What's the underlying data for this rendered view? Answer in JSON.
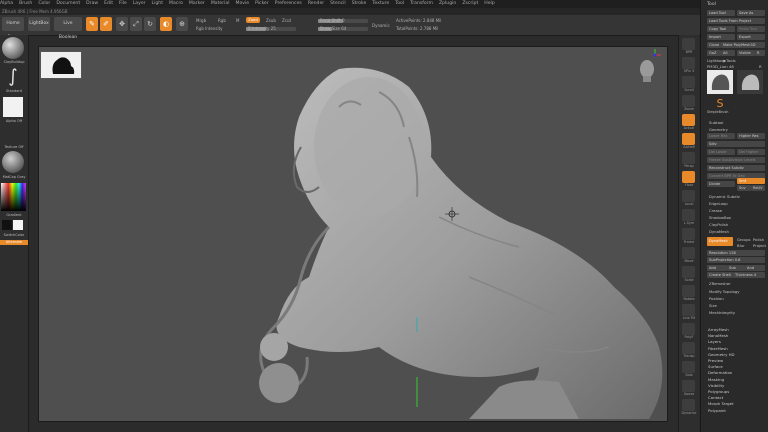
{
  "menu": [
    "Alpha",
    "Brush",
    "Color",
    "Document",
    "Draw",
    "Edit",
    "File",
    "Layer",
    "Light",
    "Macro",
    "Marker",
    "Material",
    "Movie",
    "Picker",
    "Preferences",
    "Render",
    "Stencil",
    "Stroke",
    "Texture",
    "Tool",
    "Transform",
    "Zplugin",
    "Zscript",
    "Help"
  ],
  "status_line": "ZBrush 4R6 | Free Mem 4.956GB",
  "toolbar": {
    "home_page": "Home Page",
    "lightbox": "LightBox",
    "live_boolean": "Live Boolean",
    "edit": "Edit",
    "draw": "Draw",
    "move": "Move",
    "scale": "Scale",
    "rotate": "Rotate",
    "mrgb": "Mrgb",
    "rgb": "Rgb",
    "m": "M",
    "zadd": "Zadd",
    "zsub": "Zsub",
    "zcut": "Zcut",
    "rgb_intensity": "Rgb Intensity",
    "z_intensity": "Z Intensity 25",
    "focal_shift": "Focal Shift 0",
    "draw_size": "Draw Size 64",
    "dynamic": "Dynamic",
    "active_points": "ActivePoints: 2.848 Mil",
    "total_points": "TotalPoints: 2.788 Mil"
  },
  "leftshelf": {
    "brush1": "ClayBuildup",
    "brush2": "Standard",
    "stroke": "FreeHand",
    "alpha": "Alpha Off",
    "texture": "Texture Off",
    "material": "MatCap Gray",
    "gradient": "Gradient",
    "switch_color": "SwitchColor",
    "alternate": "Alternate"
  },
  "rightshelf": [
    "BPR",
    "SPix 3",
    "Scroll",
    "Zoom",
    "Actual",
    "AAHalf",
    "Persp",
    "Floor",
    "Local",
    "L.Sym",
    "Frame",
    "Move",
    "Scale",
    "Rotate",
    "Line Fill",
    "PolyF",
    "Transp",
    "Solo",
    "Xpose",
    "Dynamic"
  ],
  "tool_panel": {
    "title": "Tool",
    "load_tool": "Load Tool",
    "save_as": "Save As",
    "load_tools_from_project": "Load Tools From Project",
    "copy_tool": "Copy Tool",
    "paste_tool": "Paste Tool",
    "import": "Import",
    "export": "Export",
    "clone": "Clone",
    "make_polymesh": "Make PolyMesh3D",
    "goz": "GoZ",
    "all": "All",
    "visible": "Visible",
    "r": "R",
    "lightbox_tools": "Lightbox▶Tools",
    "current_tool": "PM3D_Lion 48",
    "r_value": "R",
    "simple_brush": "SimpleBrush",
    "items": [
      "Subtool",
      "Geometry",
      "Lower Res",
      "Higher Res",
      "Sdiv",
      "Del Lower",
      "Del Higher",
      "Freeze SubDivision Levels",
      "Reconstruct Subdiv",
      "Convert BPR To Geo",
      "Divide",
      "Smt",
      "Suv",
      "ReUV",
      "Dynamic Subdiv",
      "EdgeLoop",
      "Crease",
      "ShadowBox",
      "ClayPolish",
      "DynaMesh"
    ],
    "dynamesh": "DynaMesh",
    "groups": "Groups",
    "polish": "Polish",
    "blur": "Blur",
    "project": "Project",
    "resolution": "Resolution 128",
    "subprojection": "SubProjection 0.6",
    "add": "Add",
    "sub": "Sub",
    "and": "And",
    "create_shell": "Create Shell",
    "thickness": "Thickness 4",
    "more": [
      "ZRemesher",
      "Modify Topology",
      "Position",
      "Size",
      "MeshIntegrity"
    ],
    "list": [
      "ArrayMesh",
      "NanoMesh",
      "Layers",
      "FiberMesh",
      "Geometry HD",
      "Preview",
      "Surface",
      "Deformation",
      "Masking",
      "Visibility",
      "Polygroups",
      "Contact",
      "Morph Target",
      "Polypaint"
    ]
  },
  "colors": {
    "accent": "#e8892a",
    "canvas": "#4f4f4f",
    "panel": "#2a2a2a"
  }
}
